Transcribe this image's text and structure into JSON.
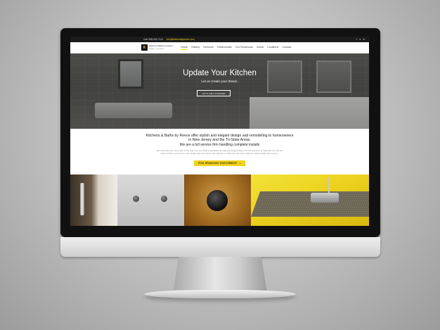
{
  "topbar": {
    "phone": "Call: 908-252-7114",
    "email": "info@kitchensbyreece.com",
    "social": [
      "f-icon",
      "twitter-icon",
      "linkedin-icon"
    ]
  },
  "logo": {
    "mark": "K",
    "name": "Kitchens & Baths by Reece",
    "tagline": "design, construct"
  },
  "nav": {
    "items": [
      "Home",
      "Gallery",
      "Services",
      "Testimonials",
      "Our Showroom",
      "About",
      "Locations",
      "Contact"
    ],
    "active": "Home"
  },
  "hero": {
    "title": "Update Your Kitchen",
    "subtitle": "Let us create your dream.",
    "button": "LET'S GET STARTED"
  },
  "content": {
    "lead": "Kitchens & Baths by Reece offer stylish and elegant design and remodeling to homeowners in New Jersey and the Tri-State Areas.",
    "sub": "We are a full service firm handling complete installs",
    "body": "We work with you every step of the way from the initial consultation through the design phase and the selection of materials to bring the vision to life in your home. Our design team are also in the industry to make sure the best products, workmanship and service.",
    "cta": "Free Showroom Consultation!",
    "cta_arrow": "→"
  },
  "colors": {
    "accent": "#f2d21b",
    "topbar": "#1b1b1b"
  }
}
